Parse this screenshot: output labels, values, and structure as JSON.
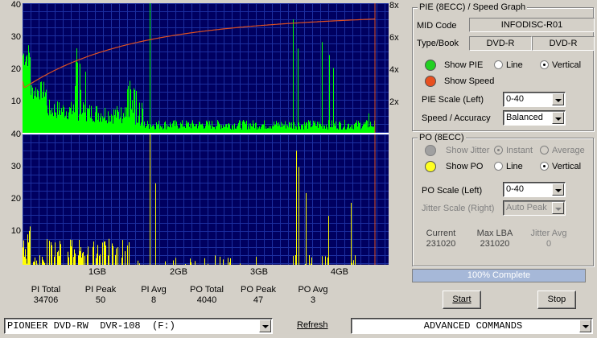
{
  "pie_chart": {
    "y_ticks": [
      "40",
      "30",
      "20",
      "10"
    ],
    "speed_ticks": [
      "8x",
      "6x",
      "4x",
      "2x"
    ]
  },
  "po_chart": {
    "y_ticks": [
      "40",
      "30",
      "20",
      "10"
    ]
  },
  "x_ticks": [
    "1GB",
    "2GB",
    "3GB",
    "4GB"
  ],
  "stats": [
    {
      "label": "PI Total",
      "value": "34706"
    },
    {
      "label": "PI Peak",
      "value": "50"
    },
    {
      "label": "PI Avg",
      "value": "8"
    },
    {
      "label": "PO Total",
      "value": "4040"
    },
    {
      "label": "PO Peak",
      "value": "47"
    },
    {
      "label": "PO Avg",
      "value": "3"
    }
  ],
  "pie_panel": {
    "title": "PIE (8ECC) / Speed Graph",
    "mid_code_label": "MID Code",
    "mid_code_value": "INFODISC-R01",
    "type_book_label": "Type/Book",
    "type_value": "DVD-R",
    "book_value": "DVD-R",
    "show_pie_label": "Show PIE",
    "show_speed_label": "Show Speed",
    "line_label": "Line",
    "vertical_label": "Vertical",
    "pie_scale_label": "PIE Scale (Left)",
    "pie_scale_value": "0-40",
    "speed_accuracy_label": "Speed / Accuracy",
    "speed_accuracy_value": "Balanced"
  },
  "po_panel": {
    "title": "PO (8ECC)",
    "show_jitter_label": "Show Jitter",
    "instant_label": "Instant",
    "average_label": "Average",
    "show_po_label": "Show PO",
    "line_label": "Line",
    "vertical_label": "Vertical",
    "po_scale_label": "PO Scale (Left)",
    "po_scale_value": "0-40",
    "jitter_scale_label": "Jitter Scale (Right)",
    "jitter_scale_value": "Auto Peak",
    "current_label": "Current",
    "current_value": "231020",
    "max_lba_label": "Max LBA",
    "max_lba_value": "231020",
    "jitter_avg_label": "Jitter Avg",
    "jitter_avg_value": "0"
  },
  "progress": {
    "text": "100% Complete",
    "fraction": 1.0
  },
  "buttons": {
    "start": "Start",
    "stop": "Stop",
    "refresh": "Refresh"
  },
  "drive_select": "PIONEER DVD-RW  DVR-108  (F:)",
  "commands_select": "ADVANCED COMMANDS",
  "colors": {
    "plot_bg": "#000060",
    "grid": "#1c2fa0",
    "pie_bars": "#00ff00",
    "po_bars": "#ffff00",
    "speed_line": "#e05020",
    "progress_fill": "#a6b8d8"
  }
}
